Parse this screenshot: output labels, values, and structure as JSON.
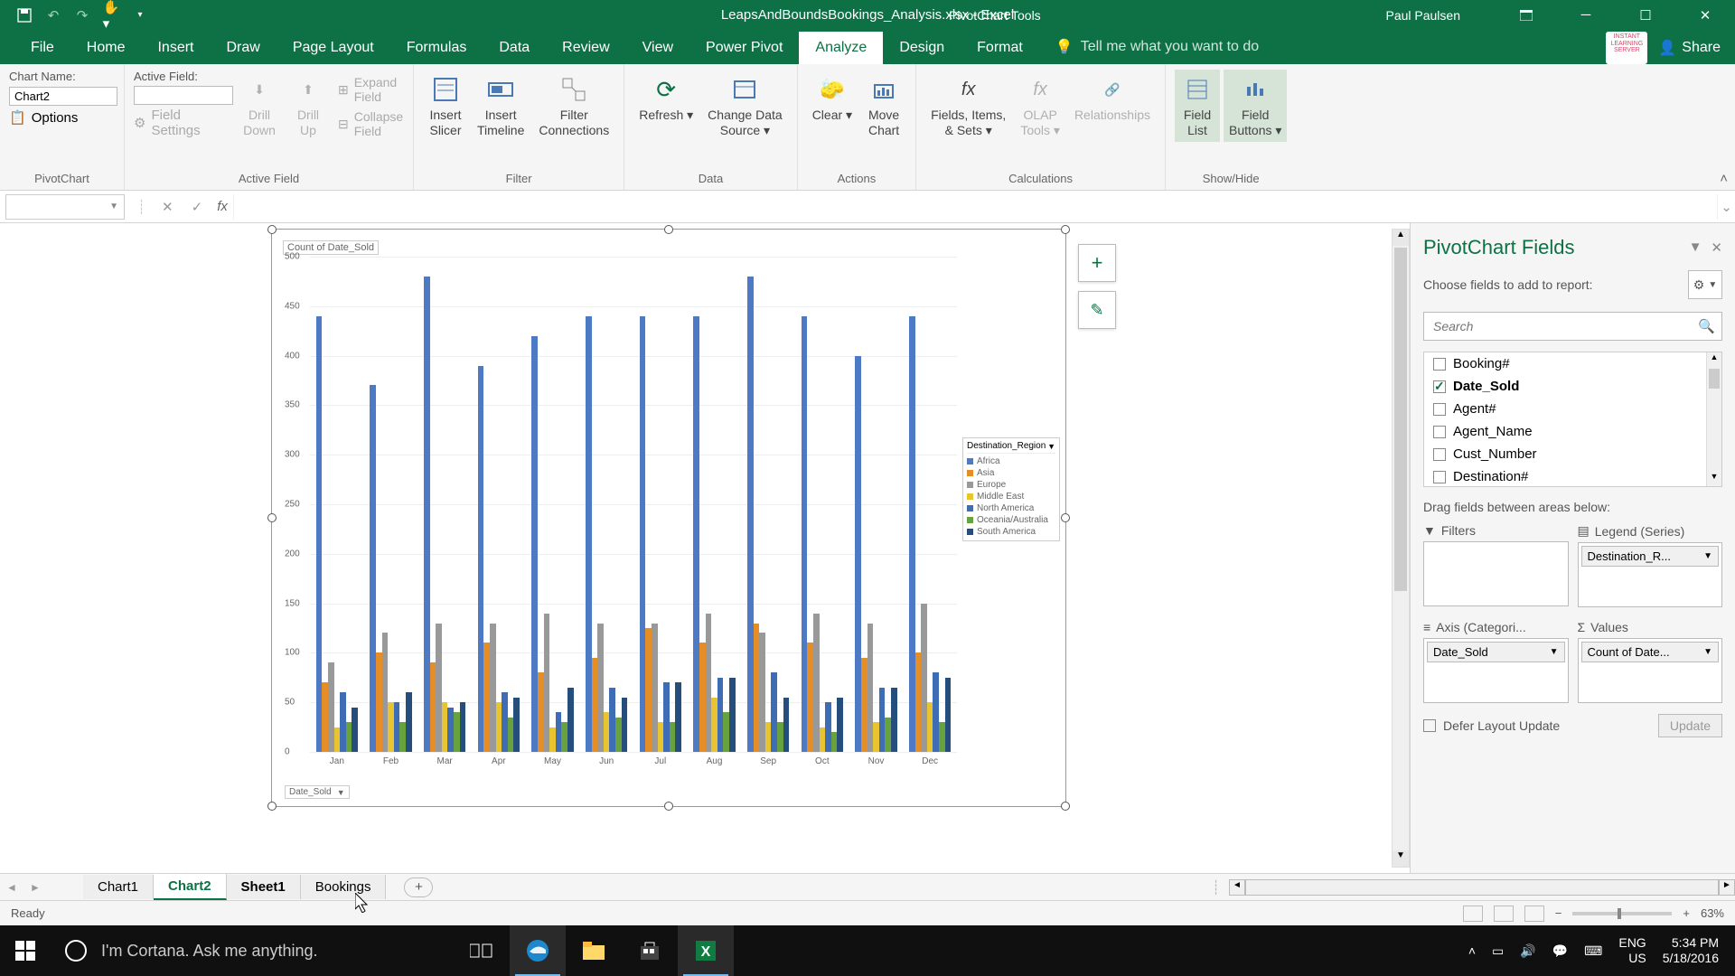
{
  "titlebar": {
    "filename": "LeapsAndBoundsBookings_Analysis.xlsx - Excel",
    "contextual": "PivotChart Tools",
    "user": "Paul Paulsen"
  },
  "ribbon": {
    "tabs": [
      "File",
      "Home",
      "Insert",
      "Draw",
      "Page Layout",
      "Formulas",
      "Data",
      "Review",
      "View",
      "Power Pivot",
      "Analyze",
      "Design",
      "Format"
    ],
    "active_tab": "Analyze",
    "tell_me": "Tell me what you want to do",
    "share": "Share",
    "logo_text": "INSTANT LEARNING SERVER",
    "groups": {
      "pivotchart": {
        "label": "PivotChart",
        "name_label": "Chart Name:",
        "name_value": "Chart2",
        "options": "Options"
      },
      "activefield": {
        "label": "Active Field",
        "af_label": "Active Field:",
        "drill_down": "Drill\nDown",
        "drill_up": "Drill\nUp",
        "expand": "Expand Field",
        "collapse": "Collapse Field",
        "settings": "Field Settings"
      },
      "filter": {
        "label": "Filter",
        "slicer": "Insert\nSlicer",
        "timeline": "Insert\nTimeline",
        "connections": "Filter\nConnections"
      },
      "data": {
        "label": "Data",
        "refresh": "Refresh",
        "change": "Change Data\nSource"
      },
      "actions": {
        "label": "Actions",
        "clear": "Clear",
        "move": "Move\nChart"
      },
      "calc": {
        "label": "Calculations",
        "fields": "Fields, Items,\n& Sets",
        "olap": "OLAP\nTools",
        "rel": "Relationships"
      },
      "showhide": {
        "label": "Show/Hide",
        "list": "Field\nList",
        "buttons": "Field\nButtons"
      }
    }
  },
  "formula_bar": {
    "name_box": "",
    "fx": "fx",
    "value": ""
  },
  "chart": {
    "title": "Count of Date_Sold",
    "axis_field": "Date_Sold",
    "legend_title": "Destination_Region",
    "side_plus": "+",
    "side_brush": "✎"
  },
  "chart_data": {
    "type": "bar",
    "ylabel": "",
    "xlabel": "",
    "ylim": [
      0,
      500
    ],
    "yticks": [
      0,
      50,
      100,
      150,
      200,
      250,
      300,
      350,
      400,
      450,
      500
    ],
    "categories": [
      "Jan",
      "Feb",
      "Mar",
      "Apr",
      "May",
      "Jun",
      "Jul",
      "Aug",
      "Sep",
      "Oct",
      "Nov",
      "Dec"
    ],
    "series": [
      {
        "name": "Africa",
        "color": "#4E79C4",
        "values": [
          440,
          370,
          480,
          390,
          420,
          440,
          440,
          440,
          480,
          440,
          400,
          440
        ]
      },
      {
        "name": "Asia",
        "color": "#E58E27",
        "values": [
          70,
          100,
          90,
          110,
          80,
          95,
          125,
          110,
          130,
          110,
          95,
          100
        ]
      },
      {
        "name": "Europe",
        "color": "#999999",
        "values": [
          90,
          120,
          130,
          130,
          140,
          130,
          130,
          140,
          120,
          140,
          130,
          150
        ]
      },
      {
        "name": "Middle East",
        "color": "#E8C530",
        "values": [
          25,
          50,
          50,
          50,
          25,
          40,
          30,
          55,
          30,
          25,
          30,
          50
        ]
      },
      {
        "name": "North America",
        "color": "#3E6DB5",
        "values": [
          60,
          50,
          45,
          60,
          40,
          65,
          70,
          75,
          80,
          50,
          65,
          80
        ]
      },
      {
        "name": "Oceania/Australia",
        "color": "#67A23F",
        "values": [
          30,
          30,
          40,
          35,
          30,
          35,
          30,
          40,
          30,
          20,
          35,
          30
        ]
      },
      {
        "name": "South America",
        "color": "#254E7C",
        "values": [
          45,
          60,
          50,
          55,
          65,
          55,
          70,
          75,
          55,
          55,
          65,
          75
        ]
      }
    ]
  },
  "fields_pane": {
    "title": "PivotChart Fields",
    "subtitle": "Choose fields to add to report:",
    "search_placeholder": "Search",
    "fields": [
      {
        "name": "Booking#",
        "checked": false
      },
      {
        "name": "Date_Sold",
        "checked": true
      },
      {
        "name": "Agent#",
        "checked": false
      },
      {
        "name": "Agent_Name",
        "checked": false
      },
      {
        "name": "Cust_Number",
        "checked": false
      },
      {
        "name": "Destination#",
        "checked": false
      }
    ],
    "drag_label": "Drag fields between areas below:",
    "areas": {
      "filters": {
        "label": "Filters",
        "items": []
      },
      "legend": {
        "label": "Legend (Series)",
        "items": [
          "Destination_R..."
        ]
      },
      "axis": {
        "label": "Axis (Categori...",
        "items": [
          "Date_Sold"
        ]
      },
      "values": {
        "label": "Values",
        "items": [
          "Count of Date..."
        ]
      }
    },
    "defer": "Defer Layout Update",
    "update": "Update"
  },
  "sheet_tabs": [
    "Chart1",
    "Chart2",
    "Sheet1",
    "Bookings"
  ],
  "active_sheet": "Chart2",
  "status_bar": {
    "ready": "Ready",
    "zoom": "63%"
  },
  "taskbar": {
    "cortana": "I'm Cortana. Ask me anything.",
    "lang": "ENG",
    "kbd": "US",
    "time": "5:34 PM",
    "date": "5/18/2016"
  }
}
